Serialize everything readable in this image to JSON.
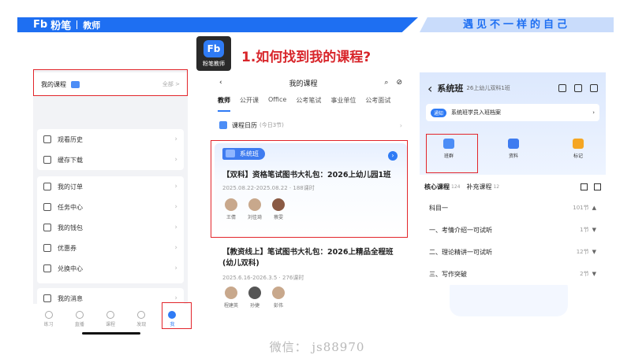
{
  "header": {
    "logo": "Fb",
    "brand_name": "粉笔",
    "brand_sub": "教师",
    "slogan": "遇见不一样的自己"
  },
  "app_icon": {
    "label": "Fb",
    "caption": "粉笔教师"
  },
  "main_title": "1.如何找到我的课程?",
  "panel1": {
    "my_course": {
      "label": "我的课程",
      "all": "全部 >"
    },
    "menu_group1": [
      {
        "label": "观看历史",
        "icon": "clock-icon"
      },
      {
        "label": "缓存下载",
        "icon": "download-icon"
      }
    ],
    "menu_group2": [
      {
        "label": "我的订单",
        "icon": "order-icon"
      },
      {
        "label": "任务中心",
        "icon": "task-icon"
      },
      {
        "label": "我的钱包",
        "icon": "wallet-icon"
      },
      {
        "label": "优惠券",
        "icon": "coupon-icon"
      },
      {
        "label": "兑换中心",
        "icon": "exchange-icon"
      }
    ],
    "menu_group3": [
      {
        "label": "我的消息",
        "icon": "message-icon"
      }
    ],
    "tabbar": [
      {
        "label": "练习"
      },
      {
        "label": "直播"
      },
      {
        "label": "课程"
      },
      {
        "label": "发现"
      },
      {
        "label": "我"
      }
    ]
  },
  "panel2": {
    "nav_title": "我的课程",
    "tabs": [
      "教师",
      "公开课",
      "Office",
      "公考笔试",
      "事业单位",
      "公考面试"
    ],
    "calendar": {
      "label": "课程日历",
      "sub": "(今日3节)"
    },
    "course1": {
      "tag": "系统班",
      "title": "【双科】资格笔试图书大礼包：2026上幼儿园1班",
      "meta": "2025.08.22-2025.08.22 · 188课时",
      "teachers": [
        "王倩",
        "刘佳琦",
        "蔡雯"
      ]
    },
    "course2": {
      "title": "【教资线上】笔试图书大礼包：2026上精品全程班(幼儿双科)",
      "meta": "2025.6.16-2026.3.5 · 276课时",
      "teachers": [
        "程建英",
        "孙捷",
        "彭伟"
      ]
    }
  },
  "panel3": {
    "nav_title": "系统班",
    "nav_sub": "26上幼儿双科1班",
    "notice": {
      "tag": "通知",
      "text": "系统班学员入班档案"
    },
    "features": [
      {
        "label": "班群",
        "icon": "chat-group-icon",
        "color": "#4c8df6"
      },
      {
        "label": "资料",
        "icon": "material-icon",
        "color": "#3f7cf0"
      },
      {
        "label": "标记",
        "icon": "mark-icon",
        "color": "#f5a623"
      }
    ],
    "tabs": {
      "core": "核心课程",
      "core_count": "124",
      "extra": "补充课程",
      "extra_count": "12"
    },
    "sections": [
      {
        "label": "科目一",
        "count": "101节",
        "arrow": "▲"
      },
      {
        "label": "一、考情介绍一可试听",
        "count": "1节",
        "arrow": "▼"
      },
      {
        "label": "二、理论精讲一可试听",
        "count": "12节",
        "arrow": "▼"
      },
      {
        "label": "三、写作突破",
        "count": "2节",
        "arrow": "▼"
      }
    ]
  },
  "watermark": "微信：  js88970",
  "colors": {
    "brand_blue": "#1e6ff2",
    "highlight_red": "#e2252b",
    "title_red": "#d8262b"
  }
}
